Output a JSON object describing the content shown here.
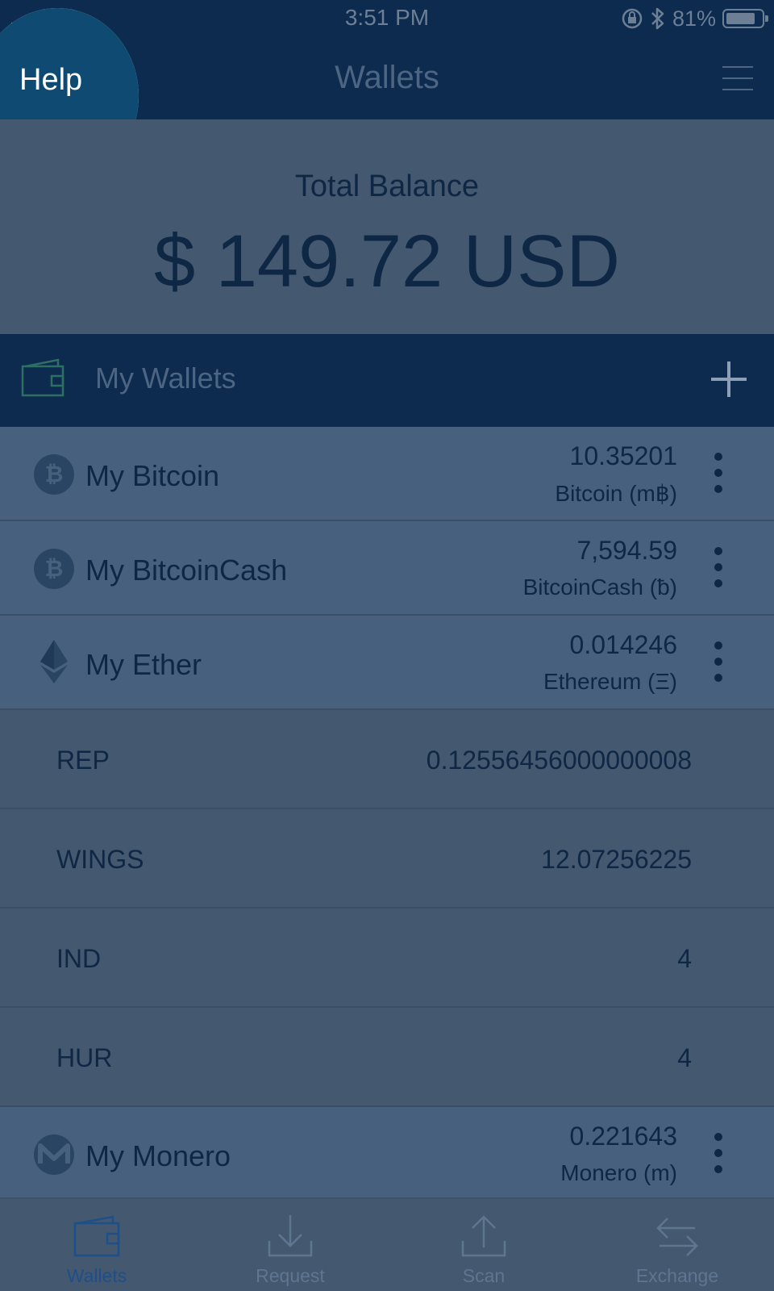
{
  "status_bar": {
    "time": "3:51 PM",
    "battery_text": "81%",
    "battery_level": 0.81
  },
  "nav": {
    "title": "Wallets",
    "help_label": "Help"
  },
  "balance": {
    "label": "Total Balance",
    "value": "$ 149.72 USD"
  },
  "wallets_header": {
    "label": "My Wallets"
  },
  "wallets": [
    {
      "name": "My Bitcoin",
      "amount": "10.35201",
      "unit": "Bitcoin (m฿)",
      "icon": "bitcoin-icon"
    },
    {
      "name": "My BitcoinCash",
      "amount": "7,594.59",
      "unit": "BitcoinCash (ƀ)",
      "icon": "bitcoin-cash-icon"
    },
    {
      "name": "My Ether",
      "amount": "0.014246",
      "unit": "Ethereum (Ξ)",
      "icon": "ethereum-icon"
    },
    {
      "name": "My Monero",
      "amount": "0.221643",
      "unit": "Monero (m)",
      "icon": "monero-icon"
    }
  ],
  "tokens": [
    {
      "name": "REP",
      "value": "0.12556456000000008"
    },
    {
      "name": "WINGS",
      "value": "12.07256225"
    },
    {
      "name": "IND",
      "value": "4"
    },
    {
      "name": "HUR",
      "value": "4"
    }
  ],
  "tabs": [
    {
      "label": "Wallets",
      "icon": "wallet-icon",
      "active": true
    },
    {
      "label": "Request",
      "icon": "download-icon",
      "active": false
    },
    {
      "label": "Scan",
      "icon": "upload-icon",
      "active": false
    },
    {
      "label": "Exchange",
      "icon": "exchange-arrows-icon",
      "active": false
    }
  ],
  "colors": {
    "nav_background": "#0d2a4f",
    "overlay_background": "#44586f",
    "help_spotlight_fill": "#0e4a72",
    "active_tab": "#1e4f8a"
  }
}
